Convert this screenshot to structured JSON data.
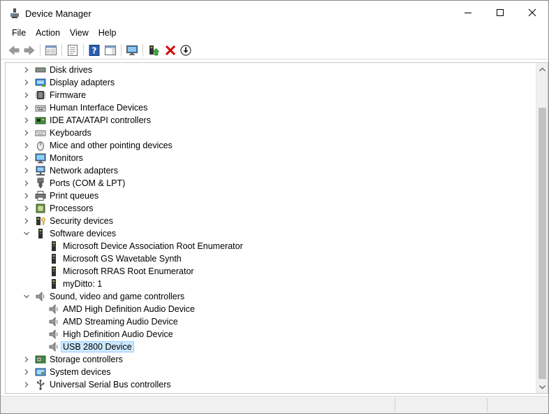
{
  "window": {
    "title": "Device Manager",
    "minimize_icon": "minimize-icon",
    "maximize_icon": "maximize-icon",
    "close_icon": "close-icon"
  },
  "menu": [
    {
      "label": "File"
    },
    {
      "label": "Action"
    },
    {
      "label": "View"
    },
    {
      "label": "Help"
    }
  ],
  "toolbar": [
    {
      "name": "back-button",
      "icon": "arrow-left-icon"
    },
    {
      "name": "forward-button",
      "icon": "arrow-right-icon"
    },
    {
      "name": "show-hide-console-tree-button",
      "icon": "console-tree-icon"
    },
    {
      "name": "properties-button",
      "icon": "properties-icon"
    },
    {
      "name": "help-button",
      "icon": "help-icon"
    },
    {
      "name": "action-pane-button",
      "icon": "action-pane-icon"
    },
    {
      "name": "scan-hardware-button",
      "icon": "monitor-scan-icon"
    },
    {
      "name": "update-driver-button",
      "icon": "update-driver-icon"
    },
    {
      "name": "uninstall-device-button",
      "icon": "red-x-icon"
    },
    {
      "name": "disable-device-button",
      "icon": "down-arrow-circle-icon"
    }
  ],
  "tree": [
    {
      "label": "Disk drives",
      "level": 0,
      "expanded": false,
      "icon": "disk-drive-icon"
    },
    {
      "label": "Display adapters",
      "level": 0,
      "expanded": false,
      "icon": "display-adapter-icon"
    },
    {
      "label": "Firmware",
      "level": 0,
      "expanded": false,
      "icon": "firmware-icon"
    },
    {
      "label": "Human Interface Devices",
      "level": 0,
      "expanded": false,
      "icon": "hid-icon"
    },
    {
      "label": "IDE ATA/ATAPI controllers",
      "level": 0,
      "expanded": false,
      "icon": "ide-controller-icon"
    },
    {
      "label": "Keyboards",
      "level": 0,
      "expanded": false,
      "icon": "keyboard-icon"
    },
    {
      "label": "Mice and other pointing devices",
      "level": 0,
      "expanded": false,
      "icon": "mouse-icon"
    },
    {
      "label": "Monitors",
      "level": 0,
      "expanded": false,
      "icon": "monitor-icon"
    },
    {
      "label": "Network adapters",
      "level": 0,
      "expanded": false,
      "icon": "network-adapter-icon"
    },
    {
      "label": "Ports (COM & LPT)",
      "level": 0,
      "expanded": false,
      "icon": "port-icon"
    },
    {
      "label": "Print queues",
      "level": 0,
      "expanded": false,
      "icon": "printer-icon"
    },
    {
      "label": "Processors",
      "level": 0,
      "expanded": false,
      "icon": "processor-icon"
    },
    {
      "label": "Security devices",
      "level": 0,
      "expanded": false,
      "icon": "security-device-icon"
    },
    {
      "label": "Software devices",
      "level": 0,
      "expanded": true,
      "icon": "software-device-icon"
    },
    {
      "label": "Microsoft Device Association Root Enumerator",
      "level": 1,
      "icon": "software-device-icon"
    },
    {
      "label": "Microsoft GS Wavetable Synth",
      "level": 1,
      "icon": "software-device-icon"
    },
    {
      "label": "Microsoft RRAS Root Enumerator",
      "level": 1,
      "icon": "software-device-icon"
    },
    {
      "label": "myDitto: 1",
      "level": 1,
      "icon": "software-device-icon"
    },
    {
      "label": "Sound, video and game controllers",
      "level": 0,
      "expanded": true,
      "icon": "speaker-icon"
    },
    {
      "label": "AMD High Definition Audio Device",
      "level": 1,
      "icon": "speaker-icon"
    },
    {
      "label": "AMD Streaming Audio Device",
      "level": 1,
      "icon": "speaker-icon"
    },
    {
      "label": "High Definition Audio Device",
      "level": 1,
      "icon": "speaker-icon"
    },
    {
      "label": "USB 2800 Device",
      "level": 1,
      "icon": "speaker-icon",
      "selected": true
    },
    {
      "label": "Storage controllers",
      "level": 0,
      "expanded": false,
      "icon": "storage-controller-icon"
    },
    {
      "label": "System devices",
      "level": 0,
      "expanded": false,
      "icon": "system-device-icon"
    },
    {
      "label": "Universal Serial Bus controllers",
      "level": 0,
      "expanded": false,
      "icon": "usb-icon"
    }
  ],
  "colors": {
    "selection": "#cce8ff",
    "selection_border": "#99d1ff",
    "scroll_thumb": "#c1c1c1",
    "delete_red": "#d40000"
  }
}
